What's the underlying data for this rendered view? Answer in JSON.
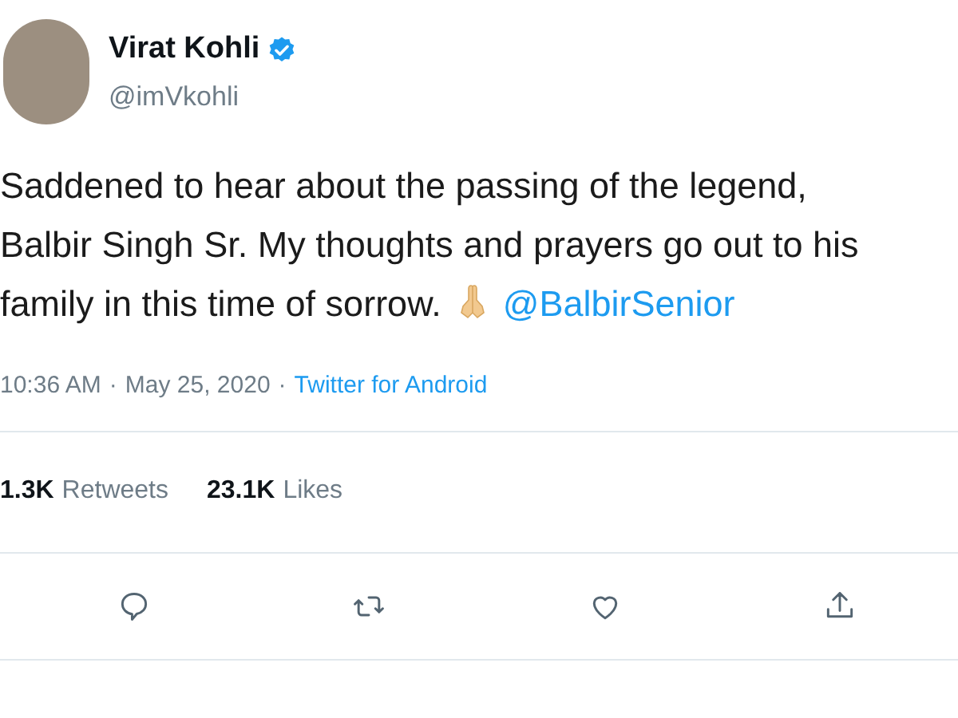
{
  "author": {
    "name": "Virat Kohli",
    "verified": true,
    "handle": "@imVkohli"
  },
  "tweet": {
    "text": "Saddened to hear about the passing of the legend, Balbir Singh Sr. My thoughts and prayers go out to his family in this time of sorrow.",
    "mention": "@BalbirSenior"
  },
  "meta": {
    "time": "10:36 AM",
    "separator": "·",
    "date": "May 25, 2020",
    "separator_2": "·",
    "source": "Twitter for Android"
  },
  "stats": [
    {
      "count": "1.3K",
      "label": "Retweets"
    },
    {
      "count": "23.1K",
      "label": "Likes"
    }
  ],
  "actions": [
    {
      "kind": "reply"
    },
    {
      "kind": "retweet"
    },
    {
      "kind": "like"
    },
    {
      "kind": "share"
    }
  ]
}
